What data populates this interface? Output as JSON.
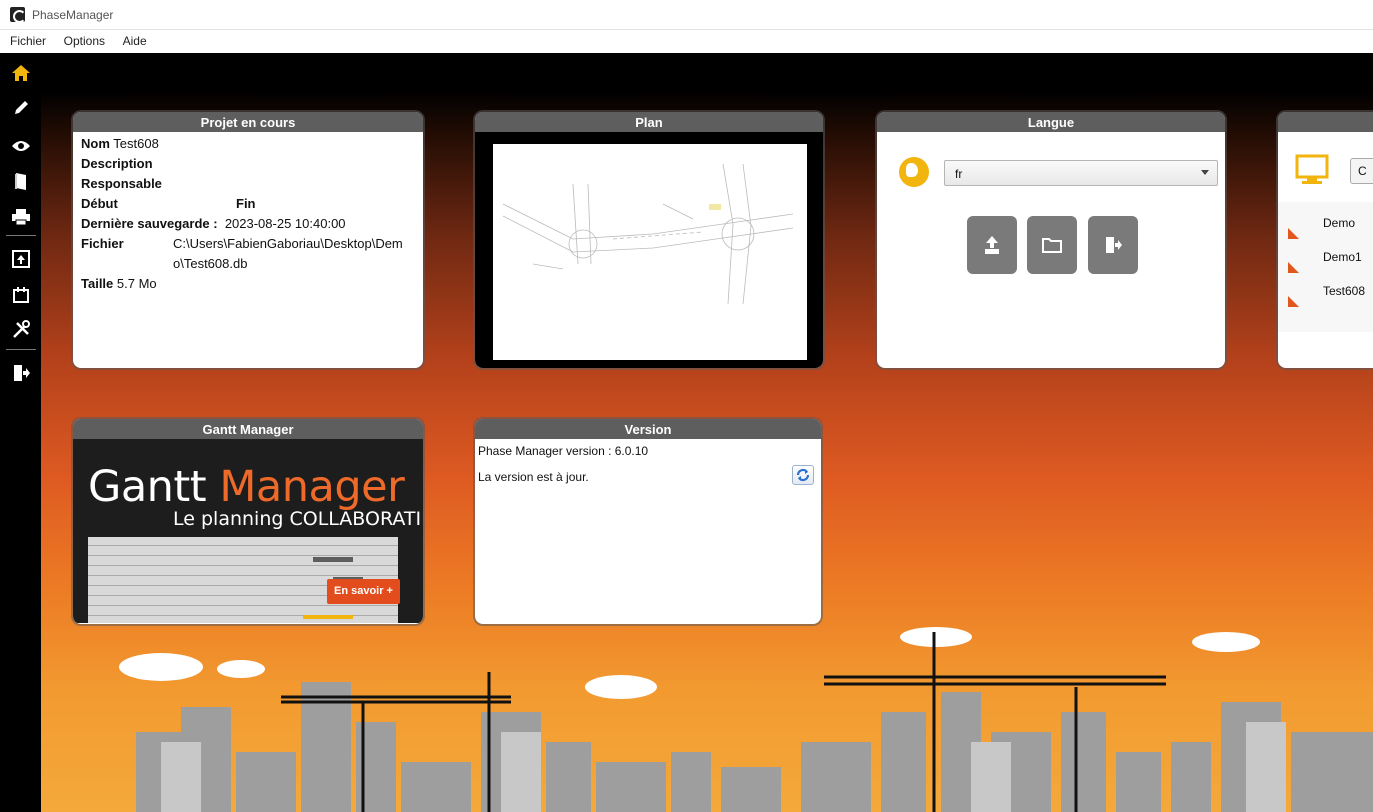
{
  "window": {
    "title": "PhaseManager"
  },
  "menu": [
    "Fichier",
    "Options",
    "Aide"
  ],
  "sidebar": [
    {
      "icon": "home-icon",
      "active": true
    },
    {
      "icon": "pencil-icon"
    },
    {
      "icon": "eye-icon"
    },
    {
      "icon": "book-icon"
    },
    {
      "icon": "printer-icon"
    },
    {
      "icon": "export-icon"
    },
    {
      "icon": "calendar-icon"
    },
    {
      "icon": "tools-icon"
    },
    {
      "icon": "exit-icon"
    }
  ],
  "project": {
    "header": "Projet en cours",
    "name_label": "Nom",
    "name_value": "Test608",
    "description_label": "Description",
    "responsible_label": "Responsable",
    "start_label": "Début",
    "end_label": "Fin",
    "saved_label": "Dernière sauvegarde :",
    "saved_value": "2023-08-25 10:40:00",
    "file_label": "Fichier",
    "file_line1": "C:\\Users\\FabienGaboriau\\Desktop\\Dem",
    "file_line2": "o\\Test608.db",
    "size_label": "Taille",
    "size_value": "5.7 Mo"
  },
  "plan": {
    "header": "Plan"
  },
  "language": {
    "header": "Langue",
    "selected": "fr"
  },
  "recent": {
    "header": "",
    "top_button": "C",
    "items": [
      "Demo",
      "Demo1",
      "Test608"
    ]
  },
  "gantt": {
    "header": "Gantt Manager",
    "title_white": "Gantt ",
    "title_orange": "Manager",
    "subtitle": "Le planning COLLABORATIF",
    "more_button": "En savoir +"
  },
  "version": {
    "header": "Version",
    "line1": "Phase Manager version : 6.0.10",
    "line2": "La version est à jour."
  },
  "colors": {
    "accent": "#e2571d",
    "header": "#5e5e5e",
    "gold": "#f1b50d",
    "sidebar": "#000000"
  }
}
